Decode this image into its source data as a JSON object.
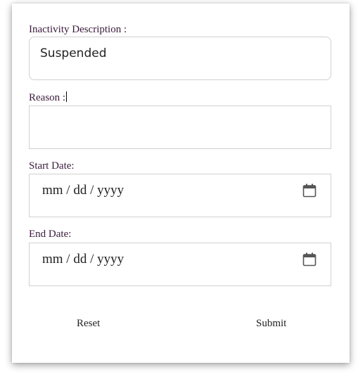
{
  "form": {
    "inactivity_description": {
      "label": "Inactivity Description :",
      "value": "Suspended"
    },
    "reason": {
      "label": "Reason :",
      "value": ""
    },
    "start_date": {
      "label": "Start Date:",
      "placeholder": "mm / dd / yyyy",
      "icon": "calendar-icon"
    },
    "end_date": {
      "label": "End Date:",
      "placeholder": "mm / dd / yyyy",
      "icon": "calendar-icon"
    },
    "buttons": {
      "reset": "Reset",
      "submit": "Submit"
    }
  }
}
